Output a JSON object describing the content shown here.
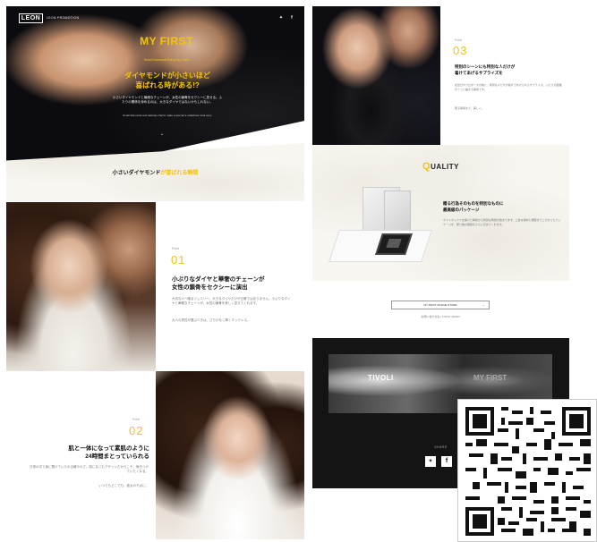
{
  "hero": {
    "brand": "LEON",
    "brand_sub": "LEON PROMOTION",
    "title": "MY FIRST",
    "subtitle_en": "Small Diamonds Bring Big Smile",
    "catch_line1": "ダイヤモンドが小さいほど",
    "catch_line2": "喜ばれる時がある!?",
    "body_jp": "小さいダイヤモンドと繊細なチェーンが、女性の鎖骨をセクシーに見せる。ふたりの関係を深めるのは、大きなダイヤではないかもしれない。",
    "body_en": "Small diamonds and delicate chains make a woman's collarbone look sexy."
  },
  "banner": {
    "text_plain": "小さいダイヤモンド",
    "text_gold": "が喜ばれる瞬間"
  },
  "section01": {
    "sub": "Point",
    "num": "01",
    "heading_l1": "小ぶりなダイヤと華奢のチェーンが",
    "heading_l2": "女性の鎖骨をセクシーに演出",
    "body": "大切な人へ贈るジュエリー。大きなダイヤだけが正解ではありません。小ぶりなダイヤと華奢なチェーンが、女性の鎖骨を美しく見せてくれます。",
    "note": "大人の男性が選ぶべきは、さりげなく輝くネックレス。"
  },
  "section02": {
    "sub": "Point",
    "num": "02",
    "heading_l1": "肌と一体になって素肌のように",
    "heading_l2": "24時間まとっていられる",
    "body": "日常の中で身に着けていられる軽やかさ。肌になじむデザインだからこそ、毎日つけていたくなる。",
    "note": "いつでもどこでも、彼女のそばに。"
  },
  "section03": {
    "sub": "Point",
    "num": "03",
    "heading_l1": "特別のシーンにも特別な人だけが",
    "heading_l2": "着けてあげるサプライズを",
    "body": "記念日やプロポーズの前に、特別な人だけが着けてあげられるサプライズ。ふたりの距離がぐっと縮まる瞬間です。",
    "note": "贈る瞬間まで、美しく。"
  },
  "quality": {
    "title_q": "Q",
    "title_rest": "UALITY",
    "heading_l1": "贈る行為そのものを特別なものに",
    "heading_l2": "最高級のパッケージ",
    "body": "ギフトボックスを開けた瞬間から特別な時間が始まります。上質な素材と細部までこだわったパッケージが、贈り物の価値をさらに高めてくれます。",
    "button_label": "MY FIRST ONLINE STORE",
    "caption": "お問い合わせ先 / TIVOLI JAPAN"
  },
  "footer": {
    "brand_tivoli": "TIVOLI",
    "brand_myfirst": "MY FIRST",
    "share_label": "SHARE"
  }
}
